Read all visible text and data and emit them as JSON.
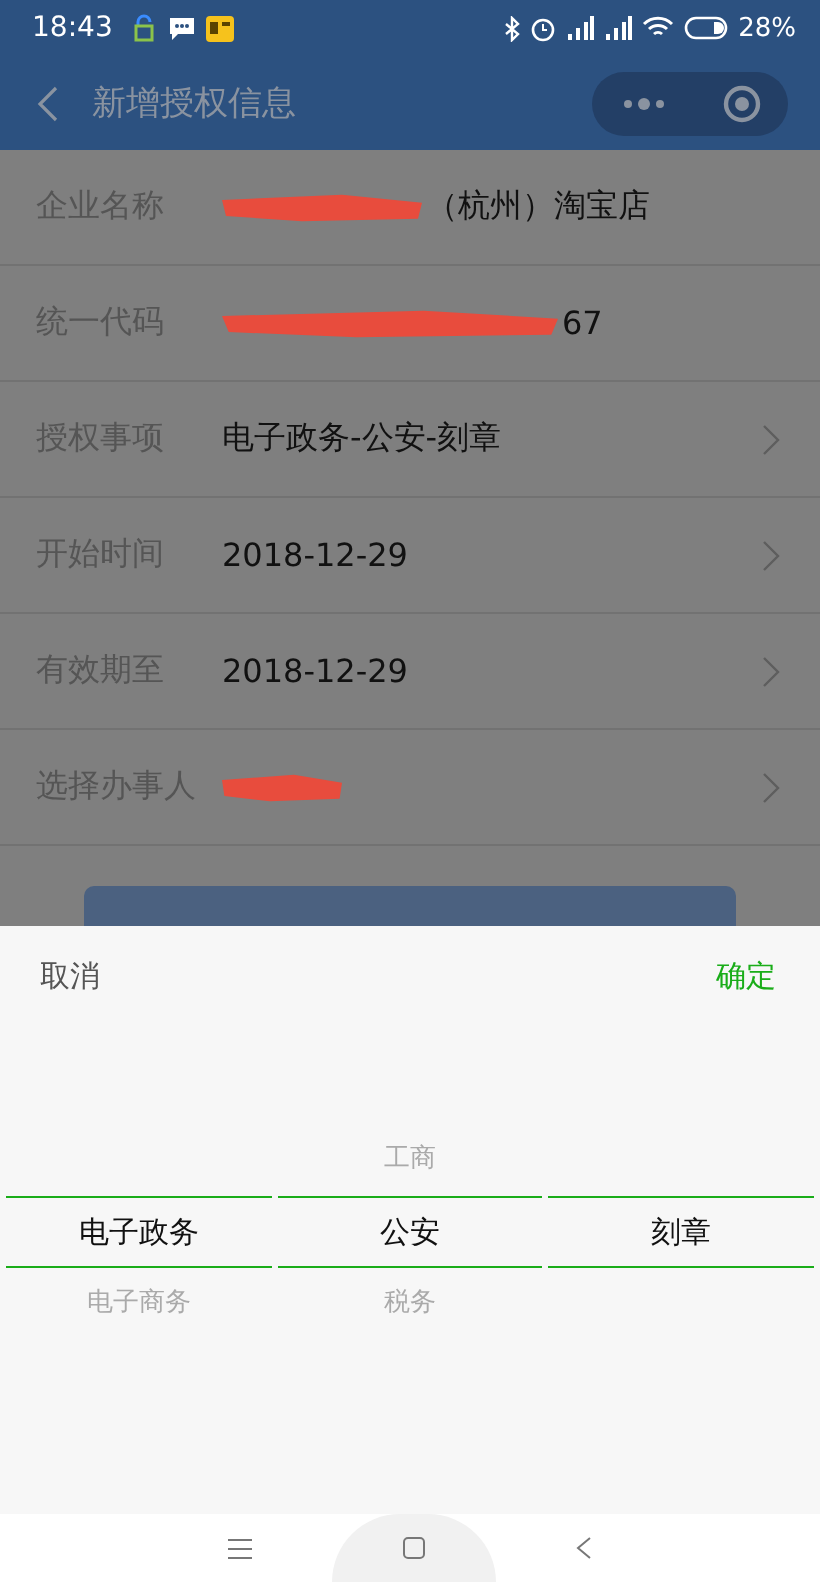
{
  "status_bar": {
    "time": "18:43",
    "battery": "28%"
  },
  "nav": {
    "title": "新增授权信息"
  },
  "form_rows": [
    {
      "label": "企业名称",
      "value": "（杭州）淘宝店",
      "redacted": true,
      "arrow": false
    },
    {
      "label": "统一代码",
      "value": "67",
      "redacted": true,
      "arrow": false
    },
    {
      "label": "授权事项",
      "value": "电子政务-公安-刻章",
      "redacted": false,
      "arrow": true
    },
    {
      "label": "开始时间",
      "value": "2018-12-29",
      "redacted": false,
      "arrow": true
    },
    {
      "label": "有效期至",
      "value": "2018-12-29",
      "redacted": false,
      "arrow": true
    },
    {
      "label": "选择办事人",
      "value": "",
      "redacted": true,
      "arrow": true
    }
  ],
  "picker": {
    "cancel": "取消",
    "confirm": "确定",
    "columns": [
      {
        "items": [
          {
            "label": "电子政务",
            "selected": true
          },
          {
            "label": "电子商务",
            "selected": false
          }
        ]
      },
      {
        "items": [
          {
            "label": "工商",
            "selected": false
          },
          {
            "label": "公安",
            "selected": true
          },
          {
            "label": "税务",
            "selected": false
          }
        ]
      },
      {
        "items": [
          {
            "label": "刻章",
            "selected": true
          }
        ]
      }
    ]
  }
}
